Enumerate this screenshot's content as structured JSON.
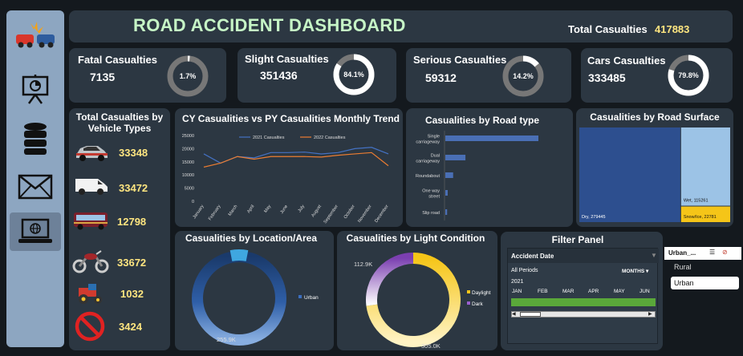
{
  "header": {
    "title": "ROAD ACCIDENT DASHBOARD",
    "total_label": "Total Casualties",
    "total_value": "417883"
  },
  "kpis": [
    {
      "label": "Fatal Casualties",
      "value": "7135",
      "pct_label": "1.7%",
      "pct": 0.017
    },
    {
      "label": "Slight Casualties",
      "value": "351436",
      "pct_label": "84.1%",
      "pct": 0.841
    },
    {
      "label": "Serious Casualties",
      "value": "59312",
      "pct_label": "14.2%",
      "pct": 0.142
    },
    {
      "label": "Cars Casualties",
      "value": "333485",
      "pct_label": "79.8%",
      "pct": 0.798
    }
  ],
  "vehicles": {
    "title": "Total Casualties by Vehicle Types",
    "items": [
      {
        "icon": "car-icon",
        "value": "33348"
      },
      {
        "icon": "van-icon",
        "value": "33472"
      },
      {
        "icon": "bus-icon",
        "value": "12798"
      },
      {
        "icon": "motorcycle-icon",
        "value": "33672"
      },
      {
        "icon": "tractor-icon",
        "value": "1032"
      },
      {
        "icon": "no-entry-icon",
        "value": "3424"
      }
    ]
  },
  "sidebar": {
    "items": [
      {
        "icon": "car-crash-icon"
      },
      {
        "icon": "presentation-icon"
      },
      {
        "icon": "database-icon"
      },
      {
        "icon": "mail-icon"
      },
      {
        "icon": "laptop-globe-icon"
      }
    ]
  },
  "trend": {
    "title": "CY Casualities vs PY Casualities Monthly Trend"
  },
  "road_type": {
    "title": "Casualities by Road type"
  },
  "surface": {
    "title": "Casualities by Road Surface"
  },
  "location": {
    "title": "Casualities by Location/Area"
  },
  "light": {
    "title": "Casualities by Light Condition"
  },
  "filter": {
    "title": "Filter Panel",
    "accident_date_label": "Accident Date",
    "all_periods": "All Periods",
    "months_label": "MONTHS",
    "year": "2021",
    "months": [
      "JAN",
      "FEB",
      "MAR",
      "APR",
      "MAY",
      "JUN"
    ],
    "slicer_title": "Urban_...",
    "slicer_options": [
      "Rural",
      "Urban"
    ]
  },
  "colors": {
    "accent_green": "#c6f5c6",
    "value_yellow": "#ffe680",
    "cy_line": "#4472c4",
    "py_line": "#ed7d31",
    "bar_blue": "#4a6fb5",
    "daylight": "#f5c518",
    "dark": "#7b3fb0"
  },
  "chart_data": [
    {
      "type": "line",
      "title": "CY Casualities vs PY Casualities Monthly Trend",
      "x": [
        "January",
        "February",
        "March",
        "April",
        "May",
        "June",
        "July",
        "August",
        "September",
        "October",
        "November",
        "December"
      ],
      "ylim": [
        0,
        25000
      ],
      "yticks": [
        "0",
        "5000",
        "10000",
        "15000",
        "20000",
        "25000"
      ],
      "series": [
        {
          "name": "2021 Casualties",
          "values": [
            18000,
            14500,
            17000,
            16500,
            18500,
            18500,
            18700,
            18000,
            18500,
            20000,
            20500,
            18000
          ]
        },
        {
          "name": "2022 Casualties",
          "values": [
            13000,
            14500,
            17000,
            16000,
            17000,
            17000,
            17000,
            16800,
            17500,
            18000,
            18500,
            13500
          ]
        }
      ]
    },
    {
      "type": "bar",
      "title": "Casualities by Road type",
      "categories": [
        "Single carriageway",
        "Dual carriageway",
        "Roundabout",
        "One way street",
        "Slip road"
      ],
      "values": [
        310000,
        67000,
        26000,
        8000,
        6000
      ],
      "orientation": "horizontal"
    },
    {
      "type": "heatmap",
      "title": "Casualities by Road Surface",
      "categories": [
        "Dry",
        "Wet",
        "Snow/Ice"
      ],
      "values": [
        279445,
        115261,
        22781
      ],
      "labels": [
        "Dry, 279445",
        "Wet, 115261",
        "Snow/Ice, 22781"
      ]
    },
    {
      "type": "pie",
      "title": "Casualities by Location/Area",
      "categories": [
        "Urban"
      ],
      "values": [
        255900
      ],
      "data_labels": [
        "255.9K"
      ]
    },
    {
      "type": "pie",
      "title": "Casualities by Light Condition",
      "categories": [
        "Daylight",
        "Dark"
      ],
      "values": [
        305000,
        112900
      ],
      "data_labels": [
        "305.0K",
        "112.9K"
      ]
    }
  ]
}
